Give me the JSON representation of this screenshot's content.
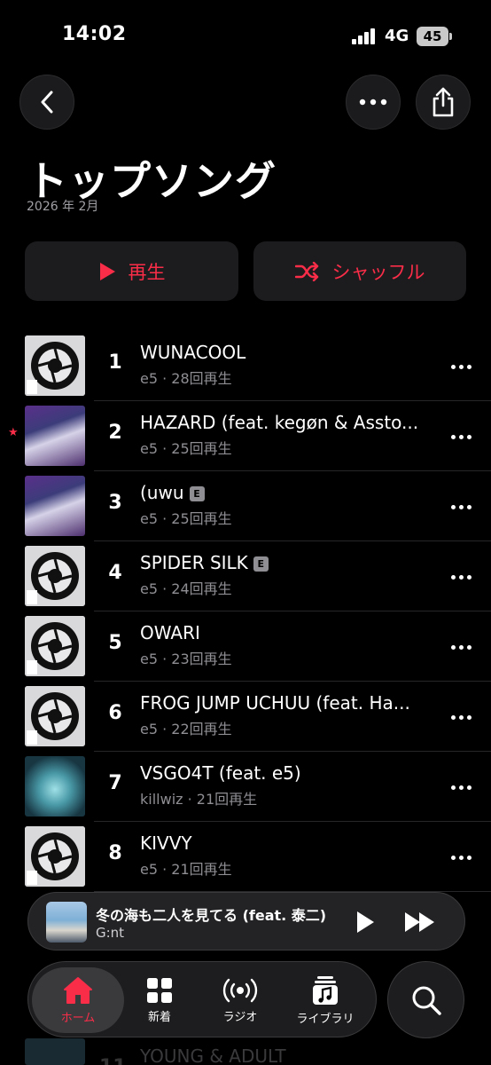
{
  "status": {
    "time": "14:02",
    "network": "4G",
    "battery": "45"
  },
  "header": {
    "title": "トップソング",
    "subtitle": "2026 年 2月"
  },
  "actions": {
    "play_label": "再生",
    "shuffle_label": "シャッフル"
  },
  "tracks": [
    {
      "rank": "1",
      "title": "WUNACOOL",
      "artist": "e5",
      "plays": "28回再生",
      "explicit": false,
      "art": "disc",
      "starred": false
    },
    {
      "rank": "2",
      "title": "HAZARD (feat. kegøn & Assto...",
      "artist": "e5",
      "plays": "25回再生",
      "explicit": false,
      "art": "car",
      "starred": true
    },
    {
      "rank": "3",
      "title": "(uwu",
      "artist": "e5",
      "plays": "25回再生",
      "explicit": true,
      "art": "car",
      "starred": false
    },
    {
      "rank": "4",
      "title": "SPIDER SILK",
      "artist": "e5",
      "plays": "24回再生",
      "explicit": true,
      "art": "disc",
      "starred": false
    },
    {
      "rank": "5",
      "title": "OWARI",
      "artist": "e5",
      "plays": "23回再生",
      "explicit": false,
      "art": "disc",
      "starred": false
    },
    {
      "rank": "6",
      "title": "FROG JUMP UCHUU (feat. Ha...",
      "artist": "e5",
      "plays": "22回再生",
      "explicit": false,
      "art": "disc",
      "starred": false
    },
    {
      "rank": "7",
      "title": "VSGO4T (feat. e5)",
      "artist": "killwiz",
      "plays": "21回再生",
      "explicit": false,
      "art": "crystal",
      "starred": false
    },
    {
      "rank": "8",
      "title": "KIVVY",
      "artist": "e5",
      "plays": "21回再生",
      "explicit": false,
      "art": "disc",
      "starred": false
    }
  ],
  "peek_track": {
    "rank": "11",
    "title": "YOUNG & ADULT"
  },
  "mini_player": {
    "song": "冬の海も二人を見てる (feat. 泰二)",
    "artist": "G:nt"
  },
  "tabs": {
    "home": "ホーム",
    "new": "新着",
    "radio": "ラジオ",
    "library": "ライブラリ"
  },
  "explicit_badge": "E",
  "colors": {
    "accent": "#fa2d48",
    "background": "#000000",
    "secondary_text": "#8e8e93"
  }
}
